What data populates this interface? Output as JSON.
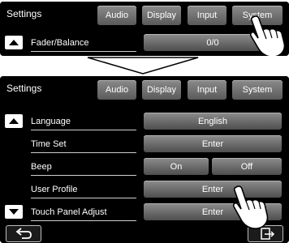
{
  "top_screen": {
    "title": "Settings",
    "tabs": [
      "Audio",
      "Display",
      "Input",
      "System"
    ],
    "row": {
      "label": "Fader/Balance",
      "value": "0/0"
    }
  },
  "main_screen": {
    "title": "Settings",
    "tabs": [
      "Audio",
      "Display",
      "Input",
      "System"
    ],
    "rows": [
      {
        "label": "Language",
        "value": "English"
      },
      {
        "label": "Time Set",
        "value": "Enter"
      },
      {
        "label": "Beep",
        "options": [
          "On",
          "Off"
        ]
      },
      {
        "label": "User Profile",
        "value": "Enter"
      },
      {
        "label": "Touch Panel Adjust",
        "value": "Enter"
      }
    ]
  },
  "icons": {
    "scroll_up": "triangle-up-icon",
    "scroll_down": "triangle-down-icon",
    "back": "back-arrow-icon",
    "exit": "exit-icon",
    "transition": "down-arrow-icon",
    "hand": "pointing-hand-icon"
  },
  "colors": {
    "screen_bg": "#000000",
    "text": "#ffffff",
    "button": "#6e6e6e"
  }
}
